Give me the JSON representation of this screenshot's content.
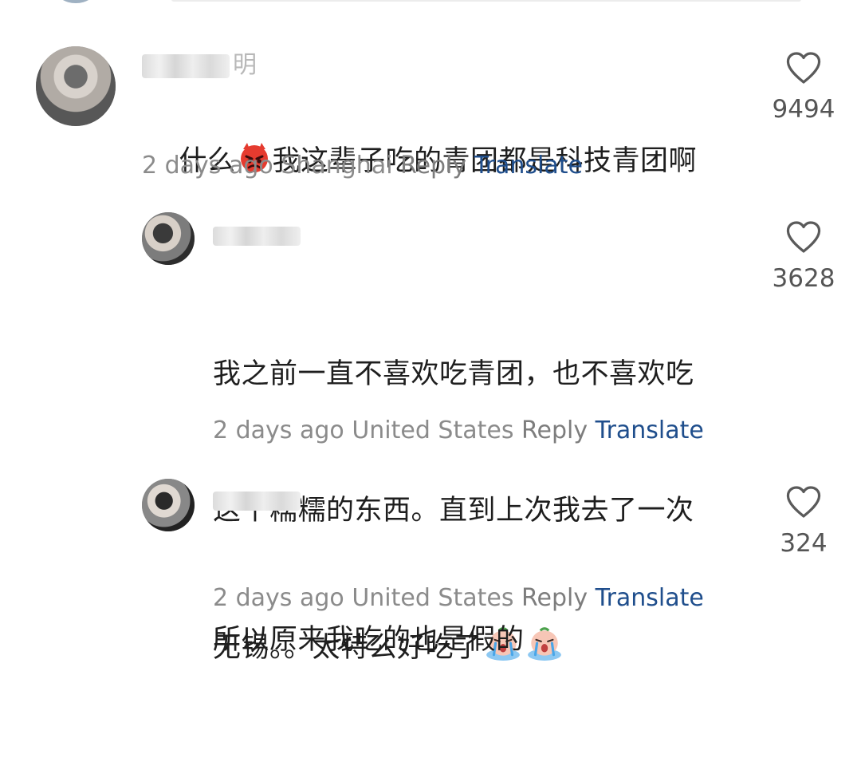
{
  "comments": [
    {
      "username_suffix": "明",
      "text": "什么[angry-face]我这辈子吃的青团都是科技青团啊",
      "text_parts": [
        "什么",
        "我这辈子吃的青团都是科技青团啊"
      ],
      "time": "2 days ago",
      "location": "Shanghai",
      "reply_label": "Reply",
      "translate_label": "Translate",
      "likes": "9494"
    },
    {
      "username_suffix": "",
      "lines": [
        "我之前一直不喜欢吃青团，也不喜欢吃",
        "这个糯糯的东西。直到上次我去了一次",
        "无锡。。太特么好吃了"
      ],
      "time": "2 days ago",
      "location": "United States",
      "reply_label": "Reply",
      "translate_label": "Translate",
      "likes": "3628"
    },
    {
      "username_suffix": "",
      "text": "所以原来我吃的也是假的",
      "time": "2 days ago",
      "location": "United States",
      "reply_label": "Reply",
      "translate_label": "Translate",
      "likes": "324"
    }
  ],
  "icons": {
    "heart": "heart-outline-icon",
    "angry": "angry-face-icon",
    "crying": "crying-face-icon"
  },
  "colors": {
    "translate": "#1f4e8c",
    "meta": "#8b8b8b",
    "text": "#1e1e1e"
  }
}
